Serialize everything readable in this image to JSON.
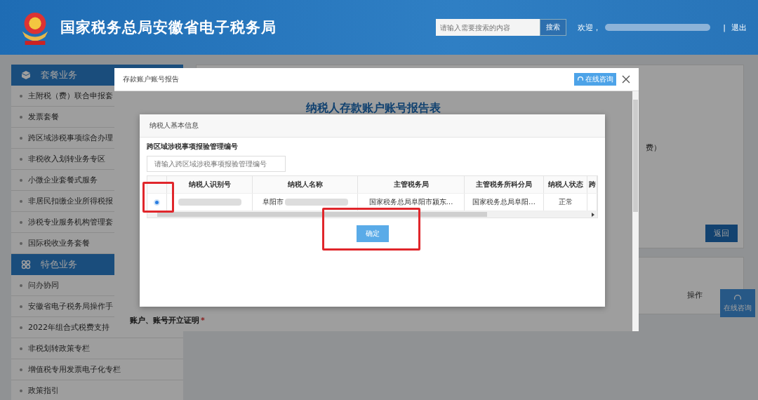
{
  "header": {
    "title": "国家税务总局安徽省电子税务局",
    "search_placeholder": "请输入需要搜索的内容",
    "search_button": "搜索",
    "welcome": "欢迎，",
    "separator": "|",
    "logout": "退出"
  },
  "sidebar": {
    "sections": [
      {
        "title": "套餐业务",
        "items": [
          "主附税（费）联合申报套",
          "发票套餐",
          "跨区域涉税事项综合办理",
          "非税收入划转业务专区",
          "小微企业套餐式服务",
          "非居民扣缴企业所得税报",
          "涉税专业服务机构管理套",
          "国际税收业务套餐"
        ]
      },
      {
        "title": "特色业务",
        "items": [
          "问办协同",
          "安徽省电子税务局操作手",
          "2022年组合式税费支持",
          "非税划转政策专栏",
          "增值税专用发票电子化专栏",
          "政策指引"
        ]
      }
    ]
  },
  "background": {
    "fragment": "费）",
    "back_button": "返回",
    "column_action": "操作",
    "float_help": "在线咨询"
  },
  "report_dialog": {
    "title": "存款账户账号报告",
    "consult_button": "在线咨询",
    "heading": "纳税人存款账户账号报告表",
    "attachment_label": "账户、账号开立证明",
    "required_mark": "*"
  },
  "info_dialog": {
    "title": "纳税人基本信息",
    "field_label": "跨区域涉税事项报验管理编号",
    "field_placeholder": "请输入跨区域涉税事项报验管理编号",
    "columns": [
      "纳税人识别号",
      "纳税人名称",
      "主管税务局",
      "主管税务所科分局",
      "纳税人状态",
      "跨"
    ],
    "rows": [
      {
        "selected": true,
        "cells": [
          "",
          "阜阳市",
          "国家税务总局阜阳市颍东…",
          "国家税务总局阜阳…",
          "正常",
          ""
        ]
      }
    ],
    "confirm_button": "确定"
  }
}
